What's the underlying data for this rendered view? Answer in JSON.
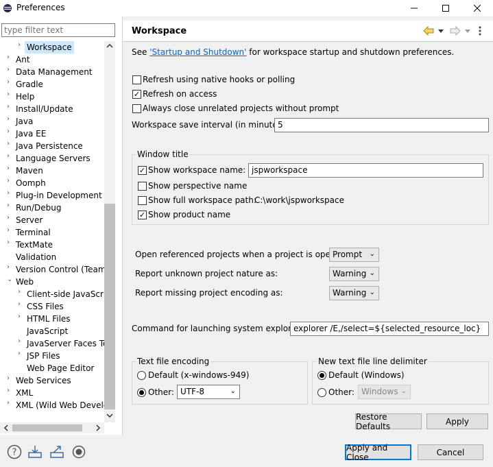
{
  "window": {
    "title": "Preferences",
    "controls": [
      "—",
      "☐",
      "✕"
    ]
  },
  "filter": {
    "placeholder": "type filter text"
  },
  "tree": [
    {
      "label": "Workspace",
      "indent": 1,
      "arrow": "›",
      "selected": true
    },
    {
      "label": "Ant",
      "indent": 0,
      "arrow": "›"
    },
    {
      "label": "Data Management",
      "indent": 0,
      "arrow": "›"
    },
    {
      "label": "Gradle",
      "indent": 0,
      "arrow": "›"
    },
    {
      "label": "Help",
      "indent": 0,
      "arrow": "›"
    },
    {
      "label": "Install/Update",
      "indent": 0,
      "arrow": "›"
    },
    {
      "label": "Java",
      "indent": 0,
      "arrow": "›"
    },
    {
      "label": "Java EE",
      "indent": 0,
      "arrow": "›"
    },
    {
      "label": "Java Persistence",
      "indent": 0,
      "arrow": "›"
    },
    {
      "label": "Language Servers",
      "indent": 0,
      "arrow": "›"
    },
    {
      "label": "Maven",
      "indent": 0,
      "arrow": "›"
    },
    {
      "label": "Oomph",
      "indent": 0,
      "arrow": "›"
    },
    {
      "label": "Plug-in Development",
      "indent": 0,
      "arrow": "›"
    },
    {
      "label": "Run/Debug",
      "indent": 0,
      "arrow": "›"
    },
    {
      "label": "Server",
      "indent": 0,
      "arrow": "›"
    },
    {
      "label": "Terminal",
      "indent": 0,
      "arrow": "›"
    },
    {
      "label": "TextMate",
      "indent": 0,
      "arrow": "›"
    },
    {
      "label": "Validation",
      "indent": 0,
      "arrow": ""
    },
    {
      "label": "Version Control (Team)",
      "indent": 0,
      "arrow": "›"
    },
    {
      "label": "Web",
      "indent": 0,
      "arrow": "⌄"
    },
    {
      "label": "Client-side JavaScript",
      "indent": 1,
      "arrow": "›"
    },
    {
      "label": "CSS Files",
      "indent": 1,
      "arrow": "›"
    },
    {
      "label": "HTML Files",
      "indent": 1,
      "arrow": "›"
    },
    {
      "label": "JavaScript",
      "indent": 1,
      "arrow": ""
    },
    {
      "label": "JavaServer Faces Tools",
      "indent": 1,
      "arrow": "›"
    },
    {
      "label": "JSP Files",
      "indent": 1,
      "arrow": "›"
    },
    {
      "label": "Web Page Editor",
      "indent": 1,
      "arrow": ""
    },
    {
      "label": "Web Services",
      "indent": 0,
      "arrow": "›"
    },
    {
      "label": "XML",
      "indent": 0,
      "arrow": "›"
    },
    {
      "label": "XML (Wild Web Developer)",
      "indent": 0,
      "arrow": "›"
    }
  ],
  "page": {
    "title": "Workspace",
    "intro_prefix": "See ",
    "intro_link": "'Startup and Shutdown'",
    "intro_suffix": " for workspace startup and shutdown preferences.",
    "refresh_native": "Refresh using native hooks or polling",
    "refresh_access": "Refresh on access",
    "always_close": "Always close unrelated projects without prompt",
    "save_interval_label": "Workspace save interval (in minutes):",
    "save_interval_value": "5",
    "window_title_group": "Window title",
    "show_ws_name": "Show workspace name:",
    "ws_name_value": "jspworkspace",
    "show_perspective": "Show perspective name",
    "show_full_path": "Show full workspace path:",
    "full_path_value": "C:\\work\\jspworkspace",
    "show_product": "Show product name",
    "open_ref_label": "Open referenced projects when a project is opened:",
    "open_ref_value": "Prompt",
    "unknown_nature_label": "Report unknown project nature as:",
    "unknown_nature_value": "Warning",
    "missing_enc_label": "Report missing project encoding as:",
    "missing_enc_value": "Warning",
    "cmd_label": "Command for launching system explorer:",
    "cmd_value": "explorer /E,/select=${selected_resource_loc}",
    "encoding_group": "Text file encoding",
    "enc_default": "Default (x-windows-949)",
    "enc_other": "Other:",
    "enc_other_value": "UTF-8",
    "delim_group": "New text file line delimiter",
    "delim_default": "Default (Windows)",
    "delim_other": "Other:",
    "delim_other_value": "Windows",
    "restore_defaults": "Restore Defaults",
    "apply": "Apply"
  },
  "footer": {
    "apply_close": "Apply and Close",
    "cancel": "Cancel"
  }
}
